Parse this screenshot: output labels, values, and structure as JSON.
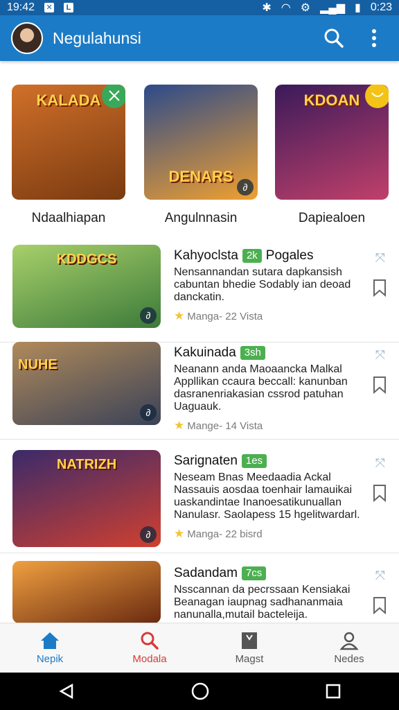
{
  "status": {
    "left_time": "19:42",
    "right_time": "0:23"
  },
  "app_bar": {
    "title": "Negulahunsi"
  },
  "featured": [
    {
      "title": "Ndaalhiapan",
      "art_title": "KALADA",
      "bg": [
        "#7a3a10",
        "#d0702a"
      ],
      "badge_color": "#3aa85a"
    },
    {
      "title": "Angulnnasin",
      "art_title": "DENARS",
      "bg": [
        "#2c4a8a",
        "#f0a030"
      ],
      "badge_color": ""
    },
    {
      "title": "Dapiealoen",
      "art_title": "KDOAN",
      "bg": [
        "#3a1a5a",
        "#c0406a"
      ],
      "badge_color": "#f3c317"
    }
  ],
  "list": [
    {
      "title": "Kahyoclsta",
      "tag": "2k",
      "title_suffix": "Pogales",
      "desc": "Nensannandan sutara dapkansish cabuntan bhedie Sodably ian deoad danckatin.",
      "meta": "Manga- 22 Vista",
      "art_title": "KDDGCS",
      "bg": [
        "#3c7a3a",
        "#a8d06a"
      ]
    },
    {
      "title": "Kakuinada",
      "tag": "3sh",
      "title_suffix": "",
      "desc": "Neanann anda Maoaancka Malkal Appllikan ccaura beccall: kanunban dasranenriakasian cssrod patuhan Uaguauk.",
      "meta": "Mange- 14 Vista",
      "art_title": "NUHE",
      "bg": [
        "#3a4258",
        "#b08a5a"
      ]
    },
    {
      "title": "Sarignaten",
      "tag": "1es",
      "title_suffix": "",
      "desc": "Neseam Bnas Meedaadia Ackal Nassauis aosdaa toenhair lamauikai uaskandintae Inanoesatikunuallan Nanulasr. Saolapess 15 hgelitwardarl.",
      "meta": "Manga- 22 bisrd",
      "art_title": "NATRIZH",
      "bg": [
        "#3a2a6a",
        "#d04030"
      ]
    },
    {
      "title": "Sadandam",
      "tag": "7cs",
      "title_suffix": "",
      "desc": "Nsscannan da pecrssaan Kensiakai Beanagan iaupnag sadhananmaia nanunalla,mutail bacteleija.",
      "meta": "",
      "art_title": "",
      "bg": [
        "#6a2a10",
        "#f0a040"
      ]
    }
  ],
  "bottom_nav": [
    {
      "label": "Nepik",
      "icon": "home-icon",
      "color": "#1c7bc6"
    },
    {
      "label": "Modala",
      "icon": "search-icon",
      "color": "#d63a3a"
    },
    {
      "label": "Magst",
      "icon": "book-icon",
      "color": "#555555"
    },
    {
      "label": "Nedes",
      "icon": "profile-icon",
      "color": "#555555"
    }
  ]
}
